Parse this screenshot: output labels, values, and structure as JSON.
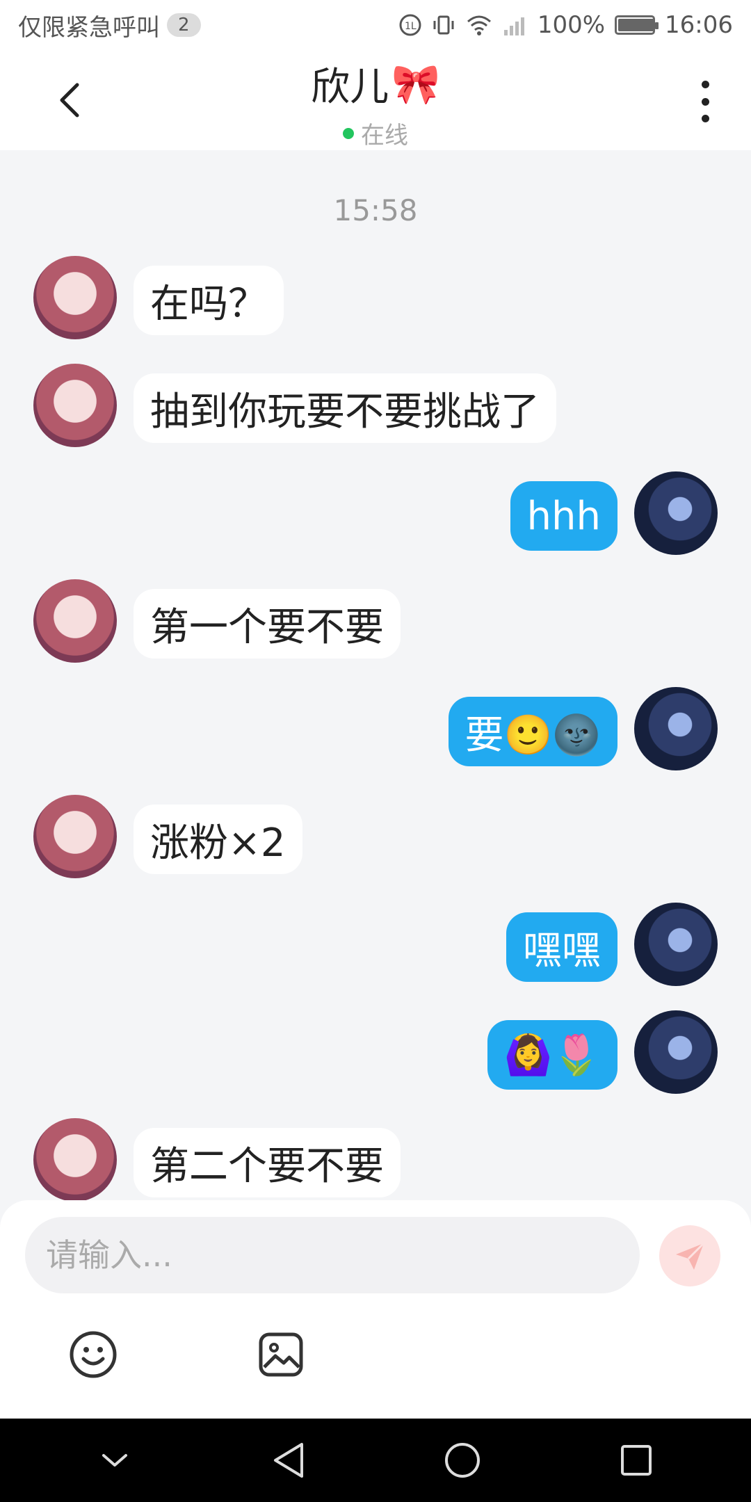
{
  "status_bar": {
    "carrier_text": "仅限紧急呼叫",
    "notif_count": "2",
    "battery_text": "100%",
    "battery_level": 1.0,
    "time": "16:06",
    "icons": [
      "hd-call-icon",
      "vibrate-icon",
      "wifi-icon",
      "signal-icon",
      "battery-icon"
    ]
  },
  "header": {
    "contact_name": "欣儿",
    "contact_emoji": "🎀",
    "presence": "在线",
    "presence_color": "#22c55e"
  },
  "chat": {
    "timestamp": "15:58",
    "messages": [
      {
        "from": "her",
        "text": "在吗？"
      },
      {
        "from": "her",
        "text": "抽到你玩要不要挑战了"
      },
      {
        "from": "me",
        "text": "hhh"
      },
      {
        "from": "her",
        "text": "第一个要不要"
      },
      {
        "from": "me",
        "text": "要🙂🌚"
      },
      {
        "from": "her",
        "text": "涨粉×2"
      },
      {
        "from": "me",
        "text": "嘿嘿"
      },
      {
        "from": "me",
        "text": "🙆‍♀️🌷"
      },
      {
        "from": "her",
        "text": "第二个要不要"
      }
    ]
  },
  "composer": {
    "placeholder": "请输入...",
    "tools": [
      "emoji-icon",
      "image-icon"
    ]
  },
  "colors": {
    "accent": "#22aaf0",
    "background": "#f4f5f7",
    "send_button": "#fde2e1"
  }
}
